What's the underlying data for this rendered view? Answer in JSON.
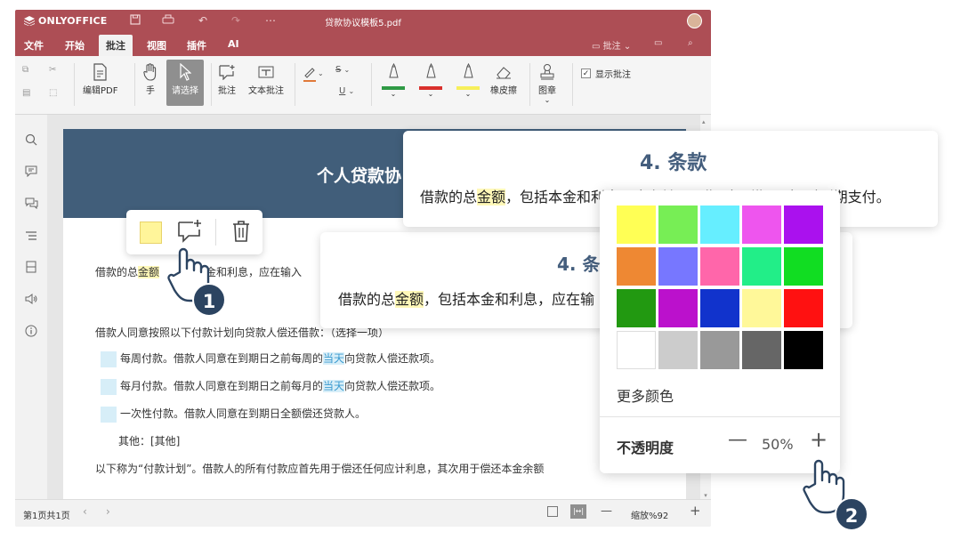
{
  "app": {
    "logo": "ONLYOFFICE",
    "doc_title": "贷款协议模板5.pdf"
  },
  "menu": {
    "items": [
      "文件",
      "开始",
      "批注",
      "视图",
      "插件",
      "AI"
    ],
    "active": "批注",
    "right_label": "批注"
  },
  "toolbar": {
    "edit_pdf": "编辑PDF",
    "hand": "手",
    "select": "请选择",
    "comment": "批注",
    "text_comment": "文本批注",
    "eraser": "橡皮擦",
    "stamp": "图章",
    "show_comments": "显示批注",
    "strike_label": "S",
    "underline_label": "U"
  },
  "document": {
    "title": "个人贷款协",
    "para1_a": "借款的总",
    "para1_hl": "金额",
    "para1_b": "本金和利息，应在输入",
    "para2": "借款人同意按照以下付款计划向贷款人偿还借款：（选择一项）",
    "opt1_a": "每周付款。借款人同意在到期日之前每周的",
    "opt1_hl": "当天",
    "opt1_b": "向贷款人偿还款项。",
    "opt2_a": "每月付款。借款人同意在到期日之前每月的",
    "opt2_hl": "当天",
    "opt2_b": "向贷款人偿还款项。",
    "opt3": "一次性付款。借款人同意在到期日全额偿还贷款人。",
    "other": "其他：[其他]",
    "para3": "以下称为“付款计划”。借款人的所有付款应首先用于偿还任何应计利息，其次用于偿还本金余额"
  },
  "callout_top": {
    "heading": "4. 条款",
    "text_a": "借款的总",
    "text_hl": "金额",
    "text_b": "，包括本金和利息，应在输入日期（“到期日”）时到期支付。"
  },
  "callout_mid": {
    "heading": "4. 条",
    "text_a": "借款的总",
    "text_hl": "金额",
    "text_b": "，包括本金和利息，应在输"
  },
  "palette": {
    "colors": [
      "#ffff55",
      "#77ee55",
      "#66eeff",
      "#ee55ee",
      "#aa11ee",
      "#ee8833",
      "#7777ff",
      "#ff66aa",
      "#22ee88",
      "#11dd22",
      "#229911",
      "#bb11cc",
      "#1133cc",
      "#fff899",
      "#ff1111",
      "#ffffff",
      "#cccccc",
      "#999999",
      "#666666",
      "#000000"
    ],
    "more_colors": "更多颜色",
    "opacity_label": "不透明度",
    "opacity_minus": "—",
    "opacity_value": "50%",
    "opacity_plus": "+"
  },
  "float_bar": {
    "highlight_color": "#fff59a"
  },
  "status": {
    "page_info": "第1页共1页",
    "zoom": "缩放%92"
  },
  "badges": {
    "one": "1",
    "two": "2"
  },
  "colors": {
    "brand": "#ad4e55",
    "header_bg": "#415e7a",
    "heading_blue": "#445e7d",
    "badge_bg": "#2c4461"
  }
}
